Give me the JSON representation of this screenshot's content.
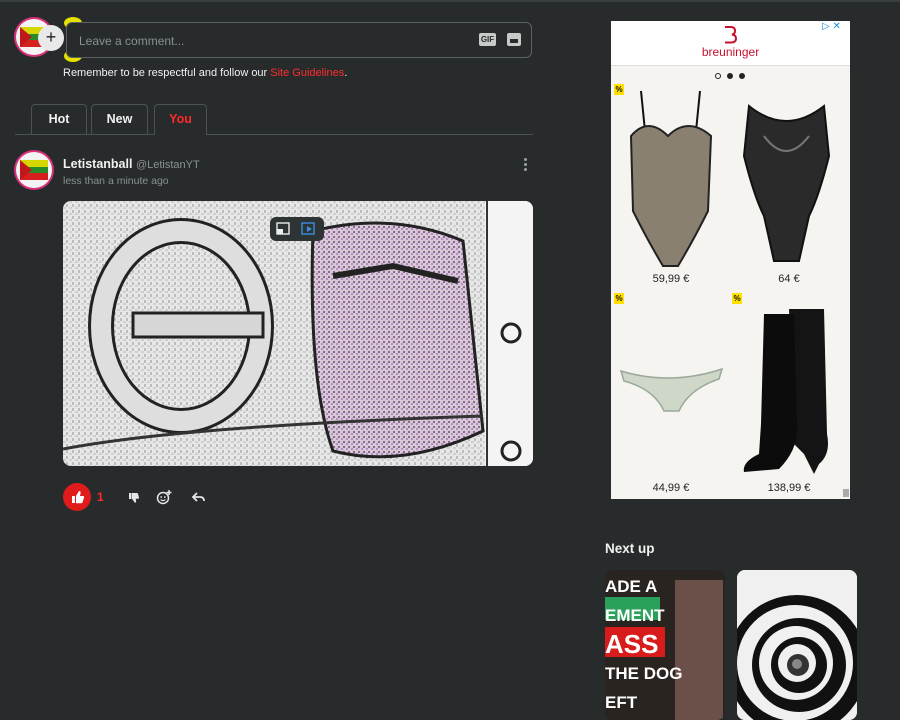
{
  "comment_composer": {
    "placeholder": "Leave a comment...",
    "add_label": "+",
    "gif_label": "GIF",
    "guidelines_prefix": "Remember to be respectful and follow our ",
    "guidelines_link": "Site Guidelines",
    "guidelines_suffix": "."
  },
  "tabs": [
    {
      "label": "Hot",
      "active": false
    },
    {
      "label": "New",
      "active": false
    },
    {
      "label": "You",
      "active": true
    }
  ],
  "comment": {
    "author": "Letistanball",
    "handle": "@LetistanYT",
    "time": "less than a minute ago",
    "likes": "1"
  },
  "ad": {
    "brand": "breuninger",
    "prices": [
      "59,99 €",
      "64 €",
      "44,99 €",
      "138,99 €"
    ],
    "badge": "%"
  },
  "sidebar": {
    "next_up_label": "Next up",
    "thumb1_lines": [
      "ADE A",
      "EMENT",
      "ASS",
      "THE DOG",
      "EFT"
    ]
  },
  "colors": {
    "background": "#272b2b",
    "accent": "#ff2a2a",
    "like_button": "#e01b1b"
  }
}
